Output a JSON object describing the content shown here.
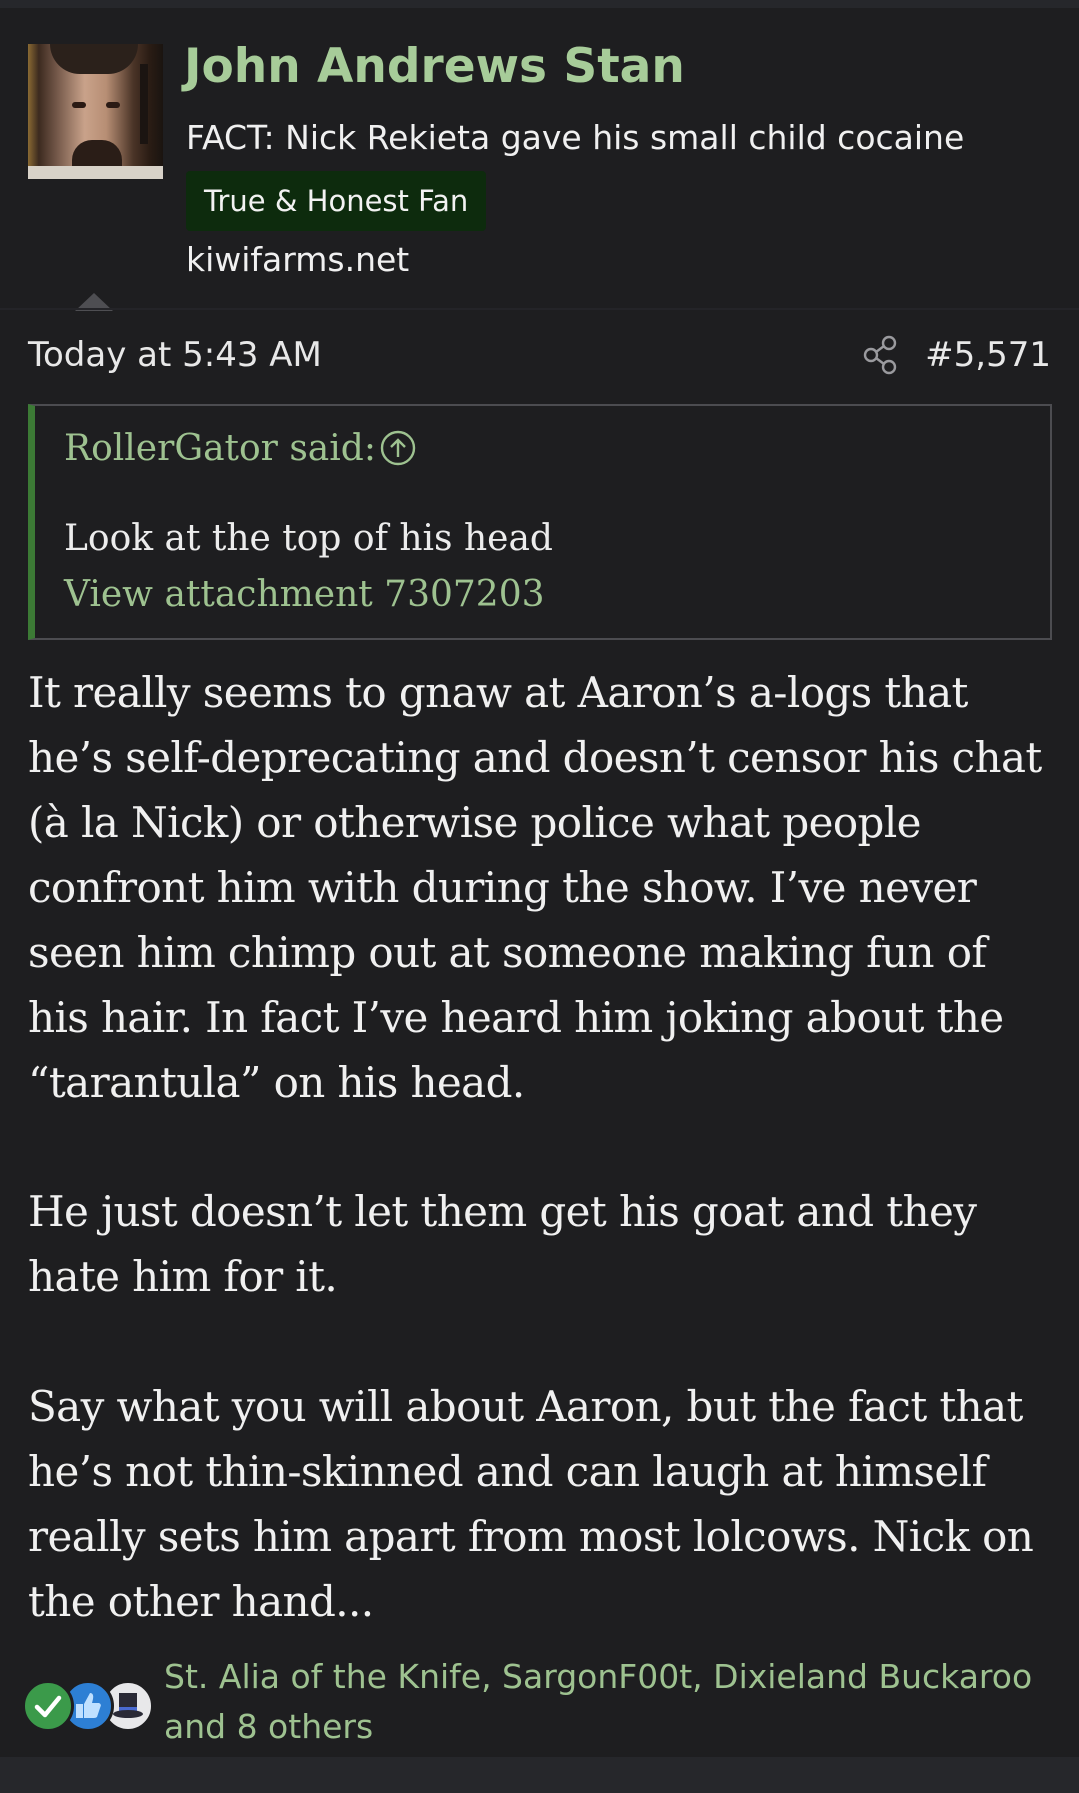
{
  "user": {
    "name": "John Andrews Stan",
    "title": "FACT: Nick Rekieta gave his small child cocaine",
    "banner": "True & Honest Fan",
    "site": "kiwifarms.net"
  },
  "post": {
    "date": "Today at 5:43 AM",
    "number": "#5,571",
    "share_icon": "share-icon"
  },
  "quote": {
    "author_said": "RollerGator said:",
    "expand_icon": "arrow-up-circle-icon",
    "text": "Look at the top of his head",
    "attachment_link": "View attachment 7307203"
  },
  "body": {
    "paragraphs": [
      "It really seems to gnaw at Aaron’s a-logs that he’s self-deprecating and doesn’t censor his chat (à la Nick) or otherwise police what people confront him with during the show. I’ve never seen him chimp out at someone making fun of his hair. In fact I’ve heard him joking about the “tarantula” on his head.",
      "He just doesn’t let them get his goat and they hate him for it.",
      "Say what you will about Aaron, but the fact that he’s not thin-skinned and can laugh at himself really sets him apart from most lolcows. Nick on the other hand..."
    ]
  },
  "reactions": {
    "icons": [
      "check-icon",
      "thumbs-up-icon",
      "top-hat-icon"
    ],
    "users_text": "St. Alia of the Knife, SargonF00t, Dixieland Buckaroo and 8 others"
  },
  "colors": {
    "background": "#1e1e20",
    "accent_green": "#a7cc99",
    "banner_bg": "#0d2b0d",
    "quote_border": "#3c7a35"
  }
}
